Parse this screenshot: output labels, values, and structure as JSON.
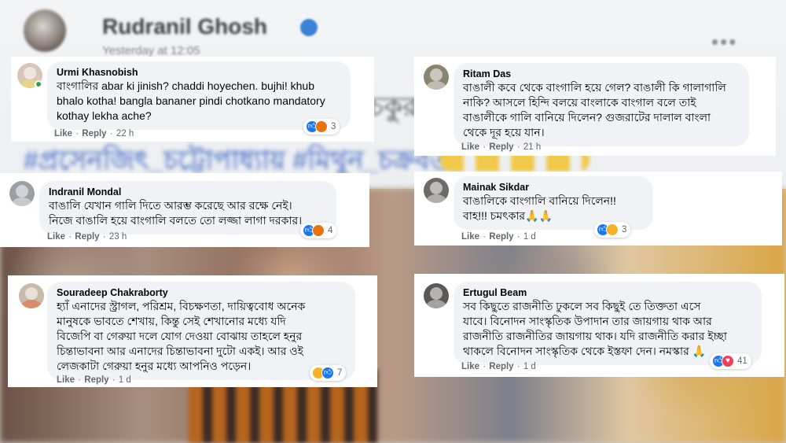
{
  "background": {
    "profile_name": "Rudranil Ghosh",
    "post_time": "Yesterday at 12:05",
    "more_menu": "•••",
    "post_text": "চকুর বকতে",
    "hashtags": "#প্রসেনজিৎ_চট্টোপাধ্যায় #মিথুন_চক্রবর্তী"
  },
  "colors": {
    "like_blue": "#1877f2",
    "haha_yellow": "#f7b125",
    "angry_orange": "#e9710f",
    "love_red": "#f33e58",
    "bubble_gray": "#f0f2f5",
    "meta_gray": "#65676b"
  },
  "comments": [
    {
      "author": "Urmi Khasnobish",
      "text": "বাংগালির abar ki jinish? chaddi hoyechen. bujhi! khub\nbhalo kotha! bangla bananer pindi chotkano mandatory\nkothay lekha ache?",
      "like": "Like",
      "reply": "Reply",
      "time": "22 h",
      "reactions": [
        "like-icon",
        "angry-icon"
      ],
      "reaction_count": "3",
      "online": true
    },
    {
      "author": "Ritam Das",
      "text": "বাঙালী কবে থেকে বাংগালি হয়ে গেল? বাঙালী কি গালাগালি\nনাকি? আসলে হিন্দি বলয়ে বাংলাকে বাংগাল বলে তাই\nবাঙালীকে গালি বানিয়ে দিলেন? গুজরাটের দালাল বাংলা\nথেকে দূর হয়ে যান।",
      "like": "Like",
      "reply": "Reply",
      "time": "21 h"
    },
    {
      "author": "Indranil Mondal",
      "text": "বাঙালি যেখান গালি দিতে আরম্ভ করেছে আর রক্ষে নেই।\nনিজে বাঙালি হয়ে বাংগালি বলতে তো লজ্জা লাগা দরকার।",
      "like": "Like",
      "reply": "Reply",
      "time": "23 h",
      "reactions": [
        "like-icon",
        "angry-icon"
      ],
      "reaction_count": "4"
    },
    {
      "author": "Mainak Sikdar",
      "text": "বাঙালিকে বাংগালি বানিয়ে দিলেন!!\nবাহ!!! চমৎকার🙏🙏",
      "like": "Like",
      "reply": "Reply",
      "time": "1 d",
      "reactions": [
        "like-icon",
        "haha-icon"
      ],
      "reaction_count": "3"
    },
    {
      "author": "Souradeep Chakraborty",
      "text": "হ্যাঁ এনাদের স্ট্রাগল, পরিশ্রম, বিচক্ষণতা, দায়িত্ববোধ অনেক\nমানুষকে ভাবতে শেখায়, কিন্তু সেই শেখানোর মধ্যে যদি\nবিজেপি বা গেরুয়া দলে যোগ দেওয়া বোঝায় তাহলে হনুর\nচিন্তাভাবনা আর এনাদের চিন্তাভাবনা দুটো একই। আর ওই\nলেজকাটা গেরুয়া হনুর মধ্যে আপনিও পড়েন।",
      "like": "Like",
      "reply": "Reply",
      "time": "1 d",
      "reactions": [
        "haha-icon",
        "like-icon"
      ],
      "reaction_count": "7"
    },
    {
      "author": "Ertugul Beam",
      "text": "সব কিছুতে রাজনীতি ঢুকলে সব কিছুই তে তিক্ততা এসে\nযাবে। বিনোদন সাংস্কৃতিক উপাদান তার জায়গায় থাক আর\nরাজনীতি রাজনীতির জায়গায় থাক। যদি রাজনীতি করার ইচ্ছা\nথাকলে বিনোদন সাংস্কৃতিক থেকে ইস্তফা দেন। নমস্কার 🙏",
      "like": "Like",
      "reply": "Reply",
      "time": "1 d",
      "reactions": [
        "like-icon",
        "love-icon"
      ],
      "reaction_count": "41"
    }
  ]
}
